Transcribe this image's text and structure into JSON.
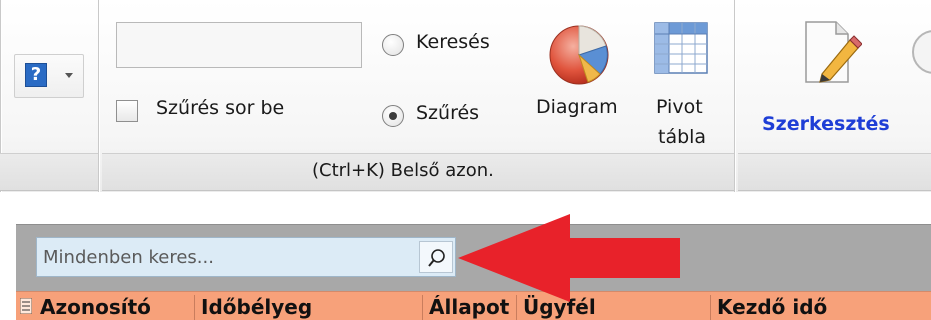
{
  "ribbon": {
    "filter_input_value": "",
    "filter_row_label": "Szűrés sor be",
    "radio_search_label": "Keresés",
    "radio_filter_label": "Szűrés",
    "selected_radio": "filter",
    "diagram_label": "Diagram",
    "pivot_label_line1": "Pivot",
    "pivot_label_line2": "tábla",
    "group_caption": "(Ctrl+K) Belső azon.",
    "edit_label": "Szerkesztés",
    "help_icon": "help-question-icon",
    "edit_label_color": "#1e3ed6"
  },
  "grid": {
    "search_placeholder": "Mindenben keres...",
    "search_icon": "magnifier-icon",
    "header_color": "#f7a17a",
    "columns": [
      "Azonosító",
      "Időbélyeg",
      "Állapot",
      "Ügyfél",
      "Kezdő idő"
    ]
  },
  "annotation": {
    "arrow_color": "#e8222a"
  }
}
